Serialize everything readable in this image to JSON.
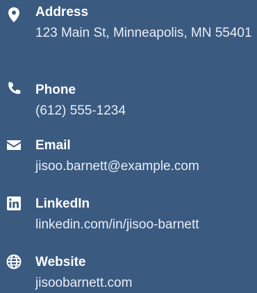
{
  "contact": {
    "items": [
      {
        "icon": "map-marker-icon",
        "label": "Address",
        "value": "123 Main St, Minneapolis, MN 55401"
      },
      {
        "icon": "phone-icon",
        "label": "Phone",
        "value": "(612) 555-1234"
      },
      {
        "icon": "envelope-icon",
        "label": "Email",
        "value": "jisoo.barnett@example.com"
      },
      {
        "icon": "linkedin-icon",
        "label": "LinkedIn",
        "value": "linkedin.com/in/jisoo-barnett"
      },
      {
        "icon": "globe-icon",
        "label": "Website",
        "value": "jisoobarnett.com"
      }
    ]
  },
  "colors": {
    "background": "#3a5a80",
    "text": "#ffffff"
  }
}
